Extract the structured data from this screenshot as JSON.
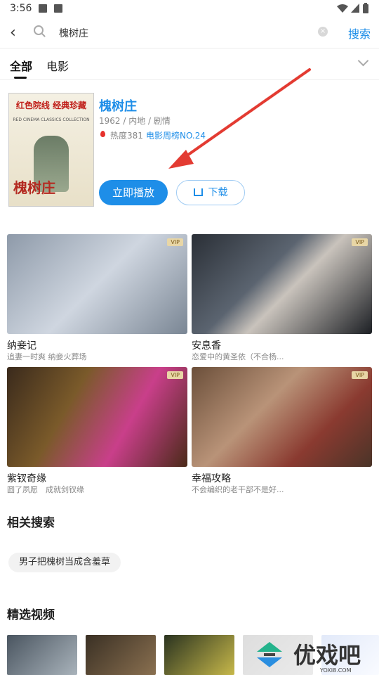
{
  "status_bar": {
    "time": "3:56"
  },
  "search": {
    "query": "槐树庄",
    "clear": "×",
    "button": "搜索"
  },
  "tabs": [
    {
      "label": "全部"
    },
    {
      "label": "电影"
    }
  ],
  "movie": {
    "poster": {
      "band": "红色院线 经典珍藏",
      "sub": "RED CINEMA CLASSICS COLLECTION",
      "title": "槐树庄"
    },
    "title": "槐树庄",
    "meta": "1962 / 内地 / 剧情",
    "heat": "热度381",
    "rank": "电影周榜NO.24",
    "play_label": "立即播放",
    "download_label": "下载"
  },
  "grid": [
    {
      "title": "纳妾记",
      "desc": "追妻一时爽 纳妾火葬场",
      "vip": "VIP"
    },
    {
      "title": "安息香",
      "desc": "恋爱中的黄圣依（不合杨...",
      "vip": "VIP"
    },
    {
      "title": "紫钗奇缘",
      "desc": "圆了夙愿　成就剑钗缘",
      "vip": "VIP"
    },
    {
      "title": "幸福攻略",
      "desc": "不会编织的老干部不是好...",
      "vip": "VIP"
    }
  ],
  "related": {
    "title": "相关搜索",
    "chips": [
      "男子把槐树当成含羞草"
    ]
  },
  "featured": {
    "title": "精选视频"
  },
  "watermark": {
    "text": "优戏吧",
    "url": "YOXI8.COM"
  },
  "colors": {
    "accent": "#1e8ee8",
    "arrow": "#e33b32",
    "vip_bg": "#e8d6a6"
  }
}
